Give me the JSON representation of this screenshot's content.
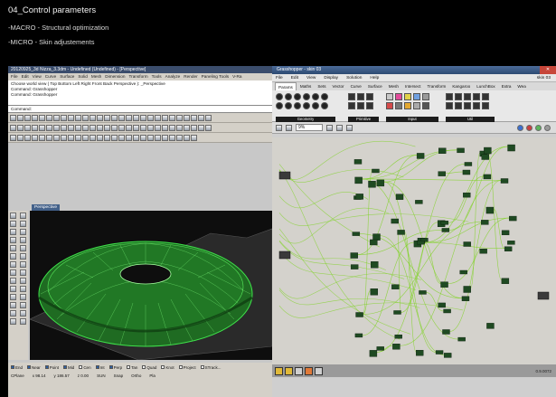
{
  "heading": "04_Control parameters",
  "notes": [
    "-MACRO - Structural optimization",
    "-MICRO - Skin adjustements"
  ],
  "rhino": {
    "title": "20120925_3d Nizza_3.3dm - Undefined (Undefined) - [Perspective]",
    "menu": [
      "File",
      "Edit",
      "View",
      "Curve",
      "Surface",
      "Solid",
      "Mesh",
      "Dimension",
      "Transform",
      "Tools",
      "Analyze",
      "Render",
      "Paneling Tools",
      "V-Ra"
    ],
    "command_history": [
      "Choose world view ( Top Bottom Left Right Front Back Perspective ): _Perspective",
      "Command: Grasshopper",
      "Command: Grasshopper"
    ],
    "command_prompt": "Command:",
    "viewport_label": "Perspective",
    "osnaps": [
      {
        "label": "End",
        "on": true
      },
      {
        "label": "Near",
        "on": true
      },
      {
        "label": "Point",
        "on": true
      },
      {
        "label": "Mid",
        "on": true
      },
      {
        "label": "Cen",
        "on": false
      },
      {
        "label": "Int",
        "on": true
      },
      {
        "label": "Perp",
        "on": true
      },
      {
        "label": "Tan",
        "on": false
      },
      {
        "label": "Quad",
        "on": false
      },
      {
        "label": "Knot",
        "on": false
      },
      {
        "label": "Project",
        "on": false
      },
      {
        "label": "STrack...",
        "on": false
      }
    ],
    "status": {
      "cplane": "CPlane",
      "x": "x 98.14",
      "y": "y 186.57",
      "z": "z 0.00",
      "layer": "SUN",
      "snap": "Snap",
      "ortho": "Ortho",
      "planar": "Pla"
    }
  },
  "grasshopper": {
    "title": "Grasshopper - skin 03",
    "menu": [
      "File",
      "Edit",
      "View",
      "Display",
      "Solution",
      "Help"
    ],
    "document_name": "skin 03",
    "tabs": [
      "Params",
      "Maths",
      "Sets",
      "Vector",
      "Curve",
      "Surface",
      "Mesh",
      "Intersect",
      "Transform",
      "Kangaroo",
      "LunchBox",
      "Extra",
      "Wea"
    ],
    "active_tab": "Params",
    "groups": [
      "Geometry",
      "Primitive",
      "Input",
      "Util"
    ],
    "zoom": "9%",
    "version": "0.9.0072"
  },
  "colors": {
    "accent_blue": "#3b4d6c",
    "mesh_green": "#2ecc40",
    "wire_green": "#7ed321"
  }
}
